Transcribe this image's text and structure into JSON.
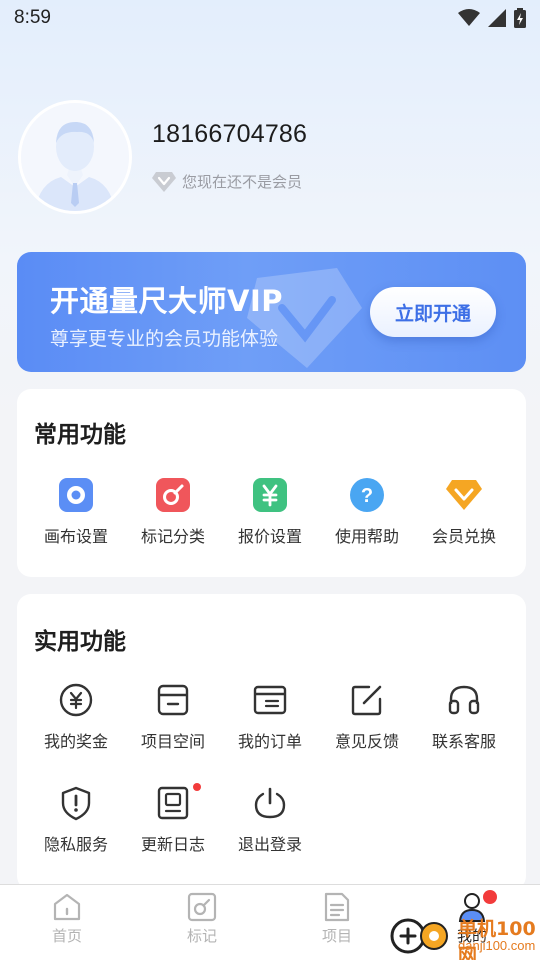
{
  "status_bar": {
    "time": "8:59"
  },
  "profile": {
    "phone": "18166704786",
    "member_status": "您现在还不是会员"
  },
  "vip_banner": {
    "title": "开通量尺大师VIP",
    "subtitle": "尊享更专业的会员功能体验",
    "button": "立即开通"
  },
  "common_functions": {
    "title": "常用功能",
    "items": [
      {
        "label": "画布设置",
        "icon": "canvas-settings-icon",
        "color": "#5b8ef5"
      },
      {
        "label": "标记分类",
        "icon": "mark-category-icon",
        "color": "#f0565b"
      },
      {
        "label": "报价设置",
        "icon": "quote-settings-icon",
        "color": "#3fc281"
      },
      {
        "label": "使用帮助",
        "icon": "help-icon",
        "color": "#4aa6f2"
      },
      {
        "label": "会员兑换",
        "icon": "member-redeem-icon",
        "color": "#f5a623"
      }
    ]
  },
  "practical_functions": {
    "title": "实用功能",
    "items": [
      {
        "label": "我的奖金",
        "icon": "bonus-icon"
      },
      {
        "label": "项目空间",
        "icon": "project-space-icon"
      },
      {
        "label": "我的订单",
        "icon": "orders-icon"
      },
      {
        "label": "意见反馈",
        "icon": "feedback-icon"
      },
      {
        "label": "联系客服",
        "icon": "headset-icon"
      },
      {
        "label": "隐私服务",
        "icon": "privacy-shield-icon"
      },
      {
        "label": "更新日志",
        "icon": "update-log-icon",
        "badge": true
      },
      {
        "label": "退出登录",
        "icon": "power-icon"
      }
    ]
  },
  "tabbar": {
    "tabs": [
      {
        "label": "首页",
        "icon": "home-icon",
        "active": false
      },
      {
        "label": "标记",
        "icon": "mark-icon",
        "active": false
      },
      {
        "label": "项目",
        "icon": "project-icon",
        "active": false
      },
      {
        "label": "我的",
        "icon": "profile-icon",
        "active": true
      }
    ]
  },
  "watermark": {
    "line1": "单机100网",
    "line2": "danji100.com"
  }
}
